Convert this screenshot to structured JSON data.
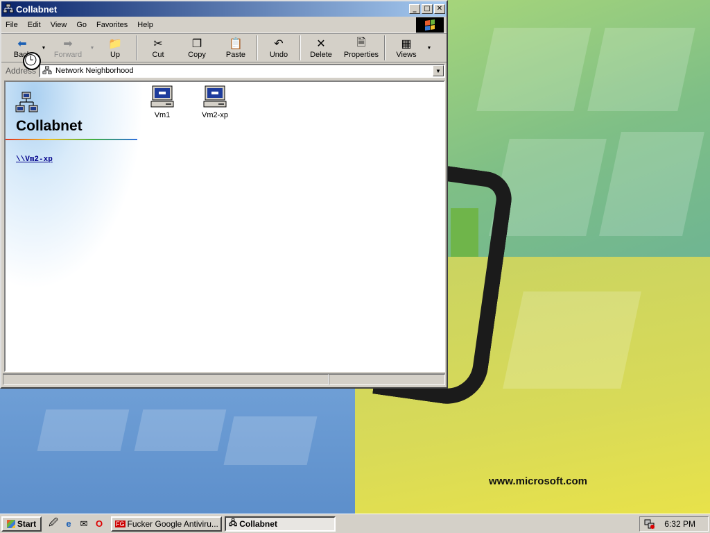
{
  "window": {
    "title": "Collabnet",
    "buttons": {
      "minimize": "_",
      "maximize": "□",
      "close": "✕"
    }
  },
  "menu": {
    "items": [
      {
        "label": "File",
        "key": "F"
      },
      {
        "label": "Edit",
        "key": "E"
      },
      {
        "label": "View",
        "key": "V"
      },
      {
        "label": "Go",
        "key": "G"
      },
      {
        "label": "Favorites",
        "key": "a"
      },
      {
        "label": "Help",
        "key": "H"
      }
    ]
  },
  "toolbar": {
    "back": "Back",
    "forward": "Forward",
    "up": "Up",
    "cut": "Cut",
    "copy": "Copy",
    "paste": "Paste",
    "undo": "Undo",
    "delete": "Delete",
    "properties": "Properties",
    "views": "Views"
  },
  "address": {
    "label": "Address",
    "value": "Network Neighborhood"
  },
  "panel": {
    "title": "Collabnet",
    "link": "\\\\Vm2-xp"
  },
  "files": [
    {
      "name": "Vm1",
      "icon": "computer-icon"
    },
    {
      "name": "Vm2-xp",
      "icon": "computer-icon"
    }
  ],
  "desktop": {
    "url": "www.microsoft.com",
    "colors": {
      "green": "#8cc36c",
      "yellow": "#e4e05a",
      "blue": "#5d8fcb"
    }
  },
  "taskbar": {
    "start": "Start",
    "tasks": [
      {
        "label": "Fucker Google Antiviru...",
        "icon": "fg-icon",
        "active": false
      },
      {
        "label": "Collabnet",
        "icon": "network-icon",
        "active": true
      }
    ],
    "quick_launch": [
      "desktop-icon",
      "ie-icon",
      "outlook-icon",
      "opera-icon"
    ],
    "clock": "6:32 PM"
  }
}
